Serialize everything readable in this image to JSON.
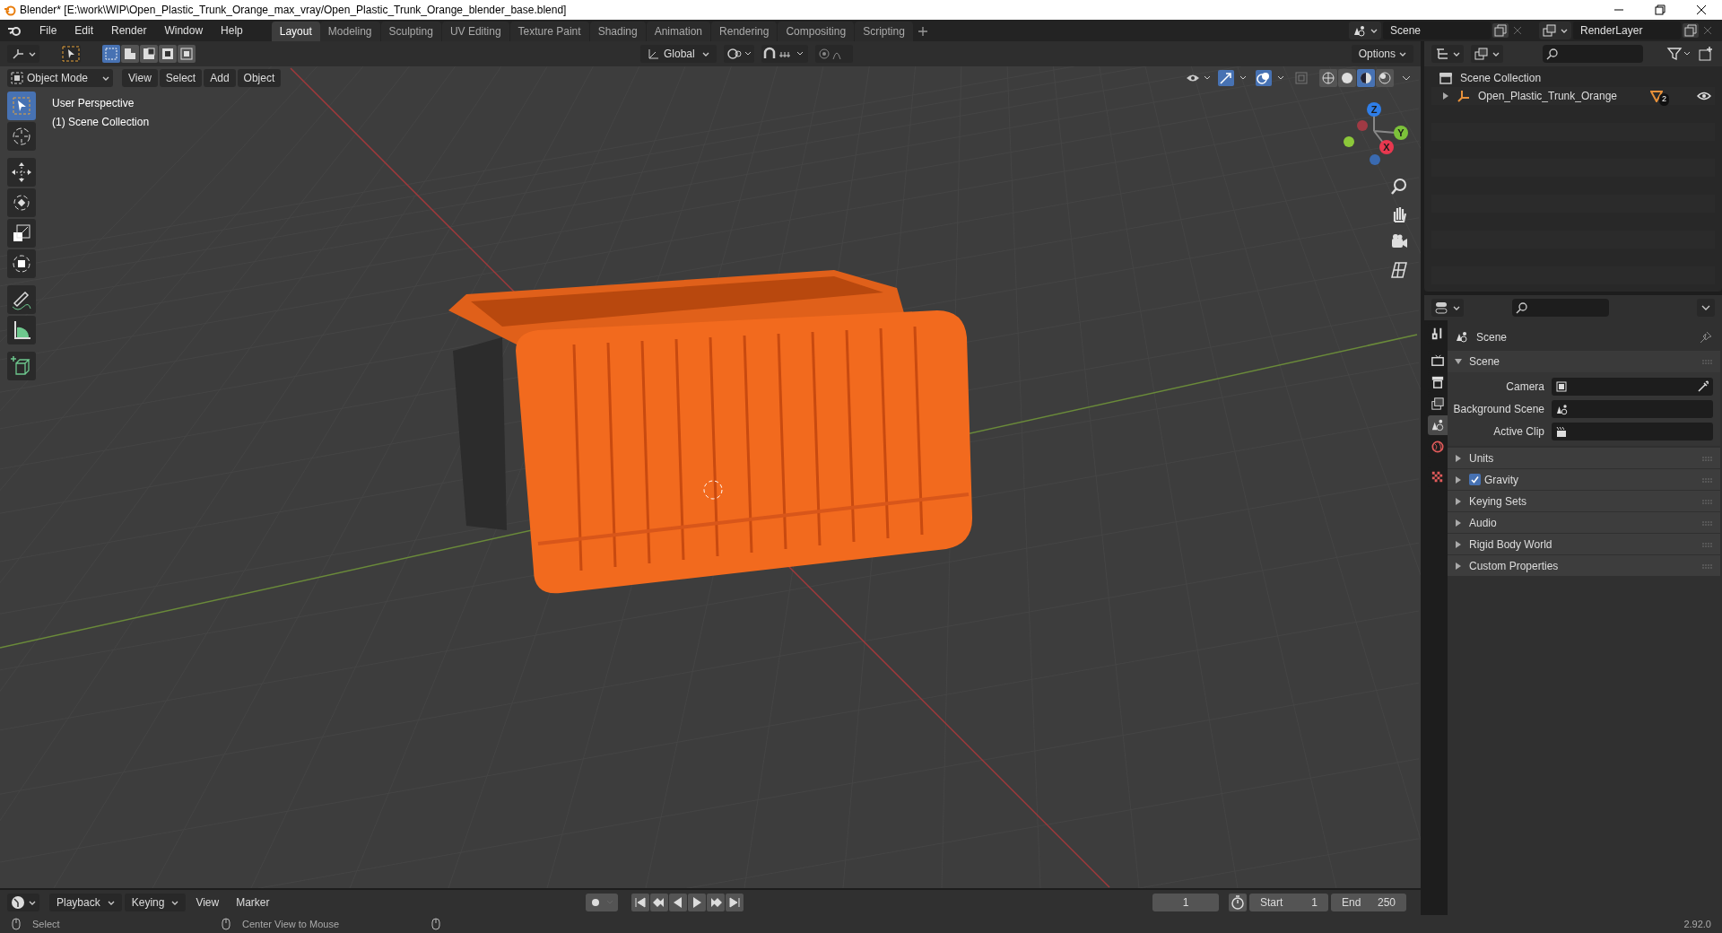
{
  "window": {
    "title": "Blender* [E:\\work\\WIP\\Open_Plastic_Trunk_Orange_max_vray/Open_Plastic_Trunk_Orange_blender_base.blend]"
  },
  "menu": [
    "File",
    "Edit",
    "Render",
    "Window",
    "Help"
  ],
  "workspaces": [
    {
      "label": "Layout",
      "selected": true
    },
    {
      "label": "Modeling",
      "selected": false
    },
    {
      "label": "Sculpting",
      "selected": false
    },
    {
      "label": "UV Editing",
      "selected": false
    },
    {
      "label": "Texture Paint",
      "selected": false
    },
    {
      "label": "Shading",
      "selected": false
    },
    {
      "label": "Animation",
      "selected": false
    },
    {
      "label": "Rendering",
      "selected": false
    },
    {
      "label": "Compositing",
      "selected": false
    },
    {
      "label": "Scripting",
      "selected": false
    }
  ],
  "scene_selector": {
    "value": "Scene"
  },
  "view_layer_selector": {
    "value": "RenderLayer"
  },
  "tool_header": {
    "select_modes": [
      {
        "selected": true
      },
      {
        "selected": false
      },
      {
        "selected": false
      },
      {
        "selected": false
      },
      {
        "selected": false
      }
    ],
    "orientation": "Global",
    "options": "Options"
  },
  "viewport_header": {
    "mode": "Object Mode",
    "menus": [
      "View",
      "Select",
      "Add",
      "Object"
    ],
    "shading": [
      {
        "selected": false
      },
      {
        "selected": false
      },
      {
        "selected": true
      },
      {
        "selected": false
      }
    ]
  },
  "viewport": {
    "overlay_lines": [
      "User Perspective",
      "(1) Scene Collection"
    ],
    "gizmo_axes": [
      "X",
      "Y",
      "Z"
    ]
  },
  "toolbar": [
    {
      "kind": "select",
      "selected": true
    },
    {
      "kind": "cursor",
      "selected": false
    },
    {
      "kind": "move",
      "selected": false
    },
    {
      "kind": "rotate",
      "selected": false
    },
    {
      "kind": "scale",
      "selected": false
    },
    {
      "kind": "transform",
      "selected": false
    },
    {
      "kind": "annotate",
      "selected": false
    },
    {
      "kind": "measure",
      "selected": false
    },
    {
      "kind": "add-cube",
      "selected": false
    }
  ],
  "outliner": {
    "root": "Scene Collection",
    "items": [
      {
        "label": "Open_Plastic_Trunk_Orange",
        "expanded": false,
        "badge": "2"
      }
    ]
  },
  "properties": {
    "tabs": [
      {
        "kind": "tool",
        "selected": false
      },
      {
        "kind": "render",
        "selected": false
      },
      {
        "kind": "output",
        "selected": false
      },
      {
        "kind": "view-layer",
        "selected": false
      },
      {
        "kind": "scene",
        "selected": true
      },
      {
        "kind": "world",
        "selected": false
      },
      {
        "kind": "texture",
        "selected": false
      }
    ],
    "context": "Scene",
    "panel": {
      "title": "Scene",
      "expanded": true,
      "fields": [
        {
          "label": "Camera",
          "kind": "camera"
        },
        {
          "label": "Background Scene",
          "kind": "scene"
        },
        {
          "label": "Active Clip",
          "kind": "clip"
        }
      ]
    },
    "subpanels": [
      {
        "title": "Units",
        "expanded": false,
        "kind": "plain"
      },
      {
        "title": "Gravity",
        "expanded": false,
        "kind": "checkbox",
        "checked": true
      },
      {
        "title": "Keying Sets",
        "expanded": false,
        "kind": "plain"
      },
      {
        "title": "Audio",
        "expanded": false,
        "kind": "plain"
      },
      {
        "title": "Rigid Body World",
        "expanded": false,
        "kind": "plain"
      },
      {
        "title": "Custom Properties",
        "expanded": false,
        "kind": "plain"
      }
    ]
  },
  "timeline": {
    "menus": [
      {
        "label": "Playback",
        "kind": "dropdown"
      },
      {
        "label": "Keying",
        "kind": "dropdown"
      },
      {
        "label": "View",
        "kind": "plain"
      },
      {
        "label": "Marker",
        "kind": "plain"
      }
    ],
    "current_frame": "1",
    "start_label": "Start",
    "start": "1",
    "end_label": "End",
    "end": "250"
  },
  "status_bar": {
    "hints": [
      "Select",
      "Center View to Mouse"
    ],
    "version": "2.92.0"
  }
}
